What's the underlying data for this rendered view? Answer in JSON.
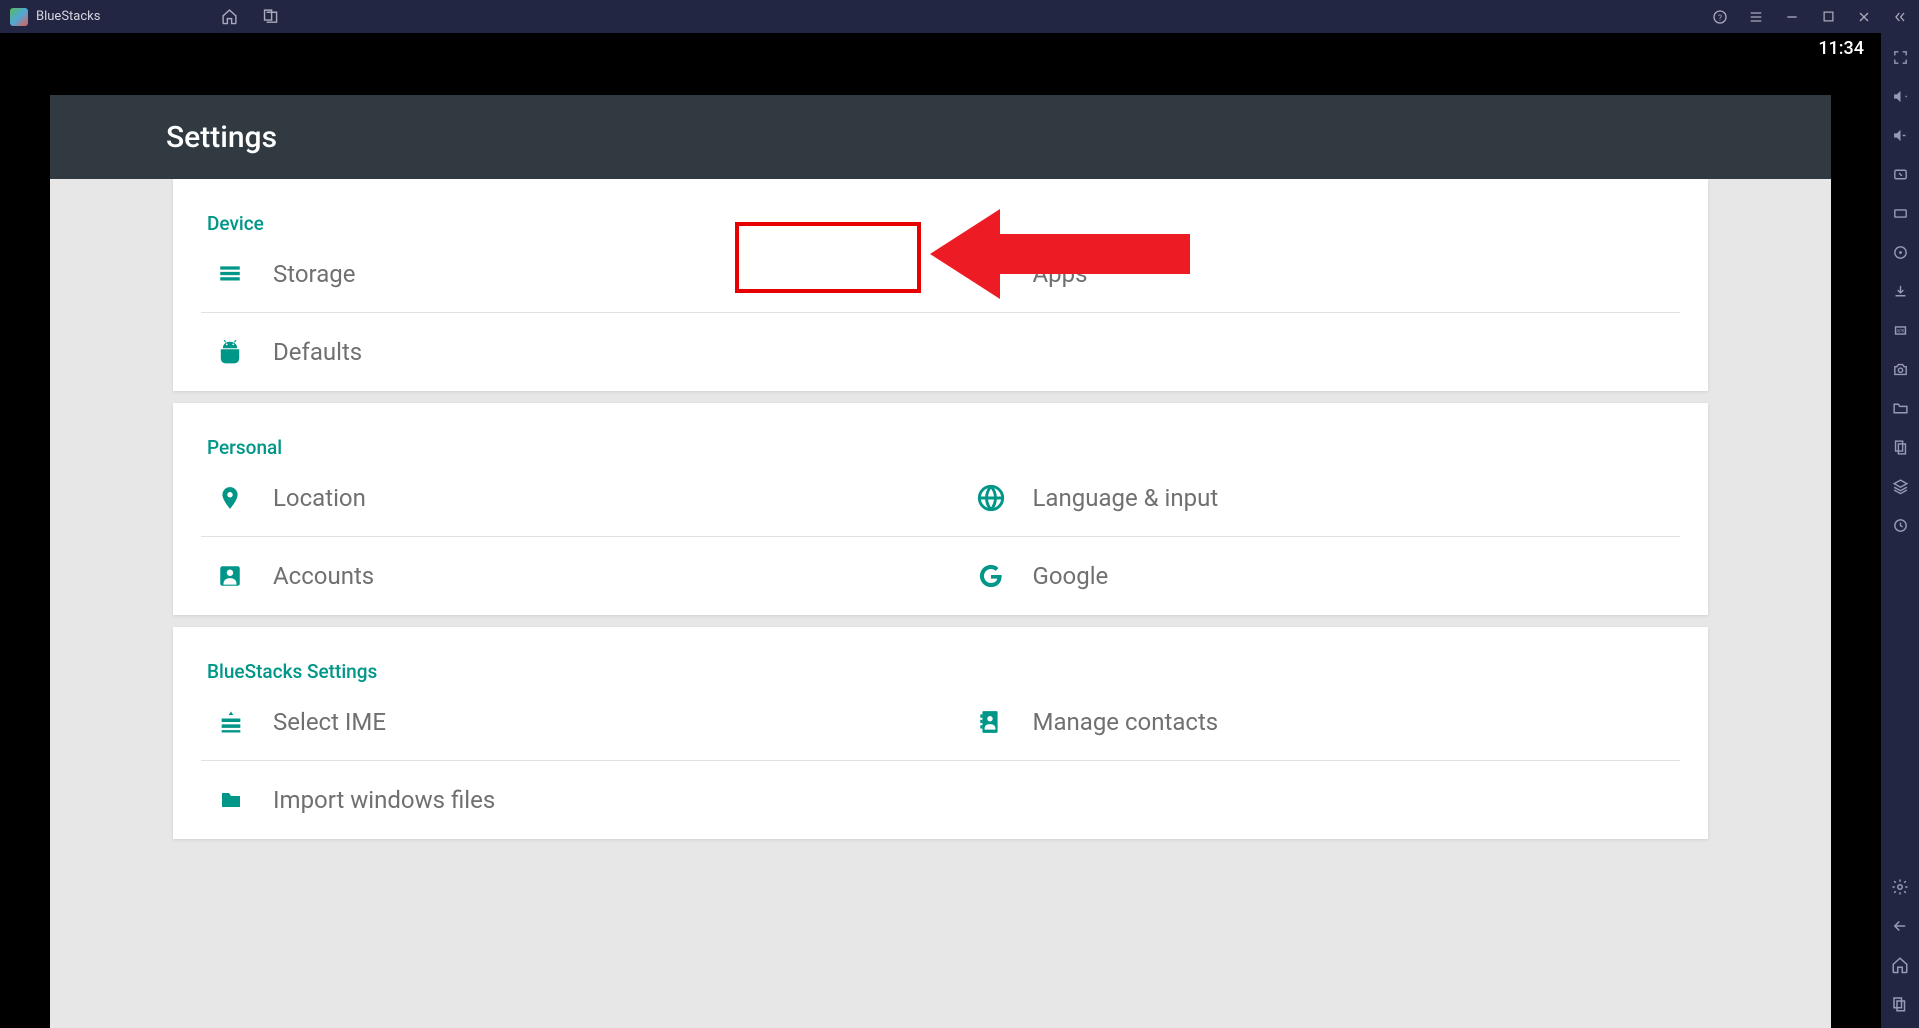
{
  "titlebar": {
    "app_name": "BlueStacks"
  },
  "status": {
    "time": "11:34"
  },
  "header": {
    "title": "Settings"
  },
  "sections": {
    "device": {
      "title": "Device",
      "storage": "Storage",
      "apps": "Apps",
      "defaults": "Defaults"
    },
    "personal": {
      "title": "Personal",
      "location": "Location",
      "language": "Language & input",
      "accounts": "Accounts",
      "google": "Google"
    },
    "bluestacks": {
      "title": "BlueStacks Settings",
      "select_ime": "Select IME",
      "manage_contacts": "Manage contacts",
      "import_files": "Import windows files"
    }
  },
  "colors": {
    "accent": "#009688",
    "titlebar": "#232642",
    "header": "#303a40",
    "highlight": "#e60000"
  }
}
